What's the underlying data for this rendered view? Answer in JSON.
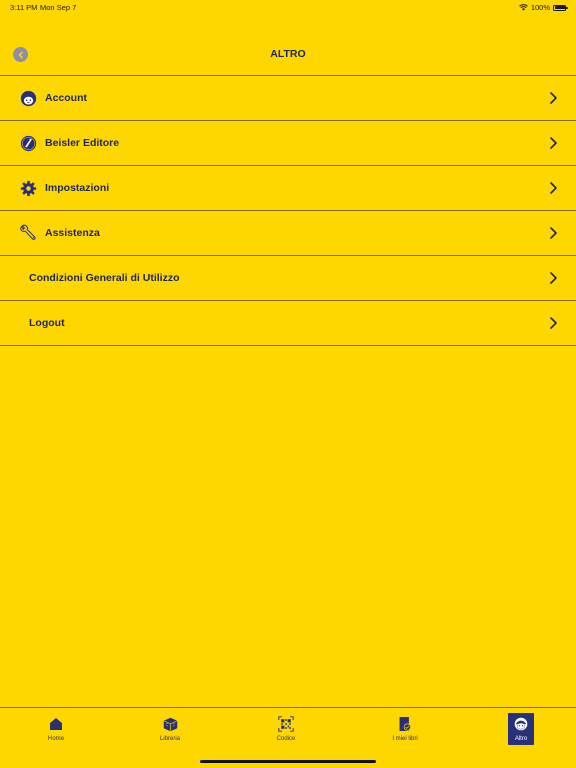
{
  "status_bar": {
    "time": "3:11 PM",
    "date": "Mon Sep 7",
    "battery": "100%"
  },
  "header": {
    "title": "ALTRO"
  },
  "menu": {
    "items": [
      {
        "label": "Account",
        "icon": "user-face-icon"
      },
      {
        "label": "Beisler Editore",
        "icon": "publisher-logo-icon"
      },
      {
        "label": "Impostazioni",
        "icon": "gear-icon"
      },
      {
        "label": "Assistenza",
        "icon": "wrench-icon"
      },
      {
        "label": "Condizioni Generali di Utilizzo",
        "icon": ""
      },
      {
        "label": "Logout",
        "icon": ""
      }
    ]
  },
  "tabs": [
    {
      "label": "Home",
      "icon": "home-icon"
    },
    {
      "label": "Libreria",
      "icon": "books-box-icon"
    },
    {
      "label": "Codice",
      "icon": "qr-code-icon"
    },
    {
      "label": "I miei libri",
      "icon": "my-books-icon"
    },
    {
      "label": "Altro",
      "icon": "user-face-icon",
      "active": true
    }
  ],
  "colors": {
    "background": "#FFD700",
    "primary": "#1f2555",
    "active_tab": "#283079",
    "divider": "#7d6a22"
  }
}
